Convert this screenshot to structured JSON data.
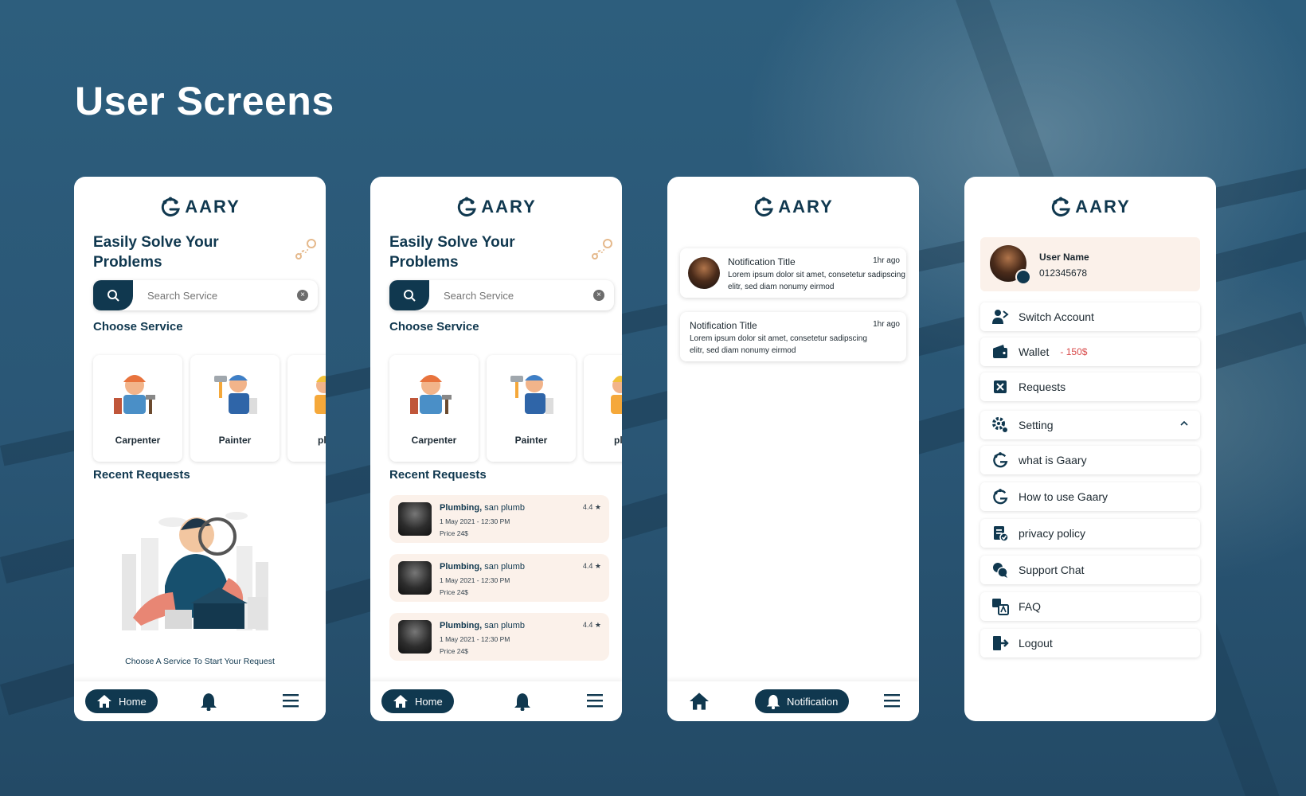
{
  "page_title": "User Screens",
  "brand": {
    "logo_text": "AARY",
    "primary_color": "#10384f",
    "accent_color": "#fbf1ea",
    "danger_color": "#d84a4a"
  },
  "home": {
    "headline": "Easily Solve Your Problems",
    "search_placeholder": "Search Service",
    "choose_service_title": "Choose Service",
    "services": [
      "Carpenter",
      "Painter",
      "pl"
    ],
    "recent_requests_title": "Recent Requests",
    "empty_caption": "Choose A Service To Start Your Request"
  },
  "requests": [
    {
      "service": "Plumbing,",
      "provider": "san plumb",
      "date": "1 May 2021 - 12:30 PM",
      "price": "Price 24$",
      "rating": "4.4 ★"
    },
    {
      "service": "Plumbing,",
      "provider": "san plumb",
      "date": "1 May 2021 - 12:30 PM",
      "price": "Price 24$",
      "rating": "4.4 ★"
    },
    {
      "service": "Plumbing,",
      "provider": "san plumb",
      "date": "1 May 2021 - 12:30 PM",
      "price": "Price 24$",
      "rating": "4.4 ★"
    }
  ],
  "notifications": [
    {
      "title": "Notification Title",
      "time": "1hr ago",
      "body": "Lorem ipsum dolor sit amet, consetetur sadipscing elitr, sed diam nonumy eirmod"
    },
    {
      "title": "Notification Title",
      "time": "1hr ago",
      "body": "Lorem ipsum dolor sit amet, consetetur sadipscing elitr, sed diam nonumy eirmod"
    }
  ],
  "nav": {
    "home": "Home",
    "notification": "Notification"
  },
  "profile": {
    "name": "User Name",
    "phone": "012345678"
  },
  "menu": {
    "switch_account": "Switch Account",
    "wallet": "Wallet",
    "wallet_balance": "- 150$",
    "requests": "Requests",
    "setting": "Setting",
    "what_is": "what is Gaary",
    "how_to_use": "How to use Gaary",
    "privacy": "privacy policy",
    "support": "Support Chat",
    "faq": "FAQ",
    "logout": "Logout"
  },
  "icons": {
    "search": "search-icon",
    "clear": "clear-icon",
    "home": "home-icon",
    "bell": "bell-icon",
    "menu": "hamburger-menu-icon",
    "route": "route-icon",
    "switch": "switch-account-icon",
    "wallet": "wallet-icon",
    "requests": "requests-icon",
    "setting": "gear-icon",
    "chevron": "chevron-up-icon",
    "logo": "gaary-logo-icon",
    "privacy": "document-check-icon",
    "support": "chat-icon",
    "faq": "translate-icon",
    "logout": "logout-icon"
  }
}
